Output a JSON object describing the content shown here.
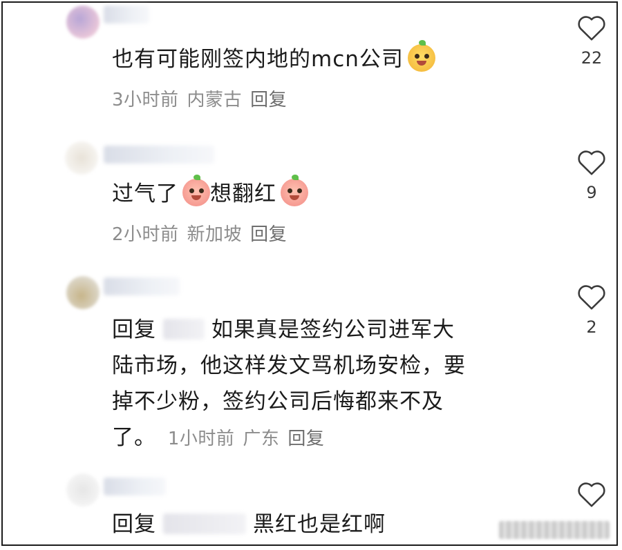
{
  "comments": [
    {
      "text": "也有可能刚签内地的mcn公司",
      "emoji_after": "sly-face-emoji",
      "meta": {
        "time": "3小时前",
        "location": "内蒙古",
        "reply": "回复"
      },
      "likes": "22"
    },
    {
      "text_a": "过气了",
      "text_b": "想翻红",
      "meta": {
        "time": "2小时前",
        "location": "新加坡",
        "reply": "回复"
      },
      "likes": "9"
    },
    {
      "reply_prefix": "回复",
      "body_line1_rest": "如果真是签约公司进军大",
      "body_line2": "陆市场，他这样发文骂机场安检，要",
      "body_line3": "掉不少粉，签约公司后悔都来不及",
      "body_line4": "了。",
      "meta": {
        "time": "1小时前",
        "location": "广东",
        "reply": "回复"
      },
      "likes": "2"
    },
    {
      "reply_prefix": "回复",
      "body": "黑红也是红啊"
    }
  ],
  "icons": {
    "like": "heart-outline-icon"
  },
  "colors": {
    "text": "#1b1b1b",
    "meta": "#8c8c8c",
    "border": "#1b1b1b"
  }
}
